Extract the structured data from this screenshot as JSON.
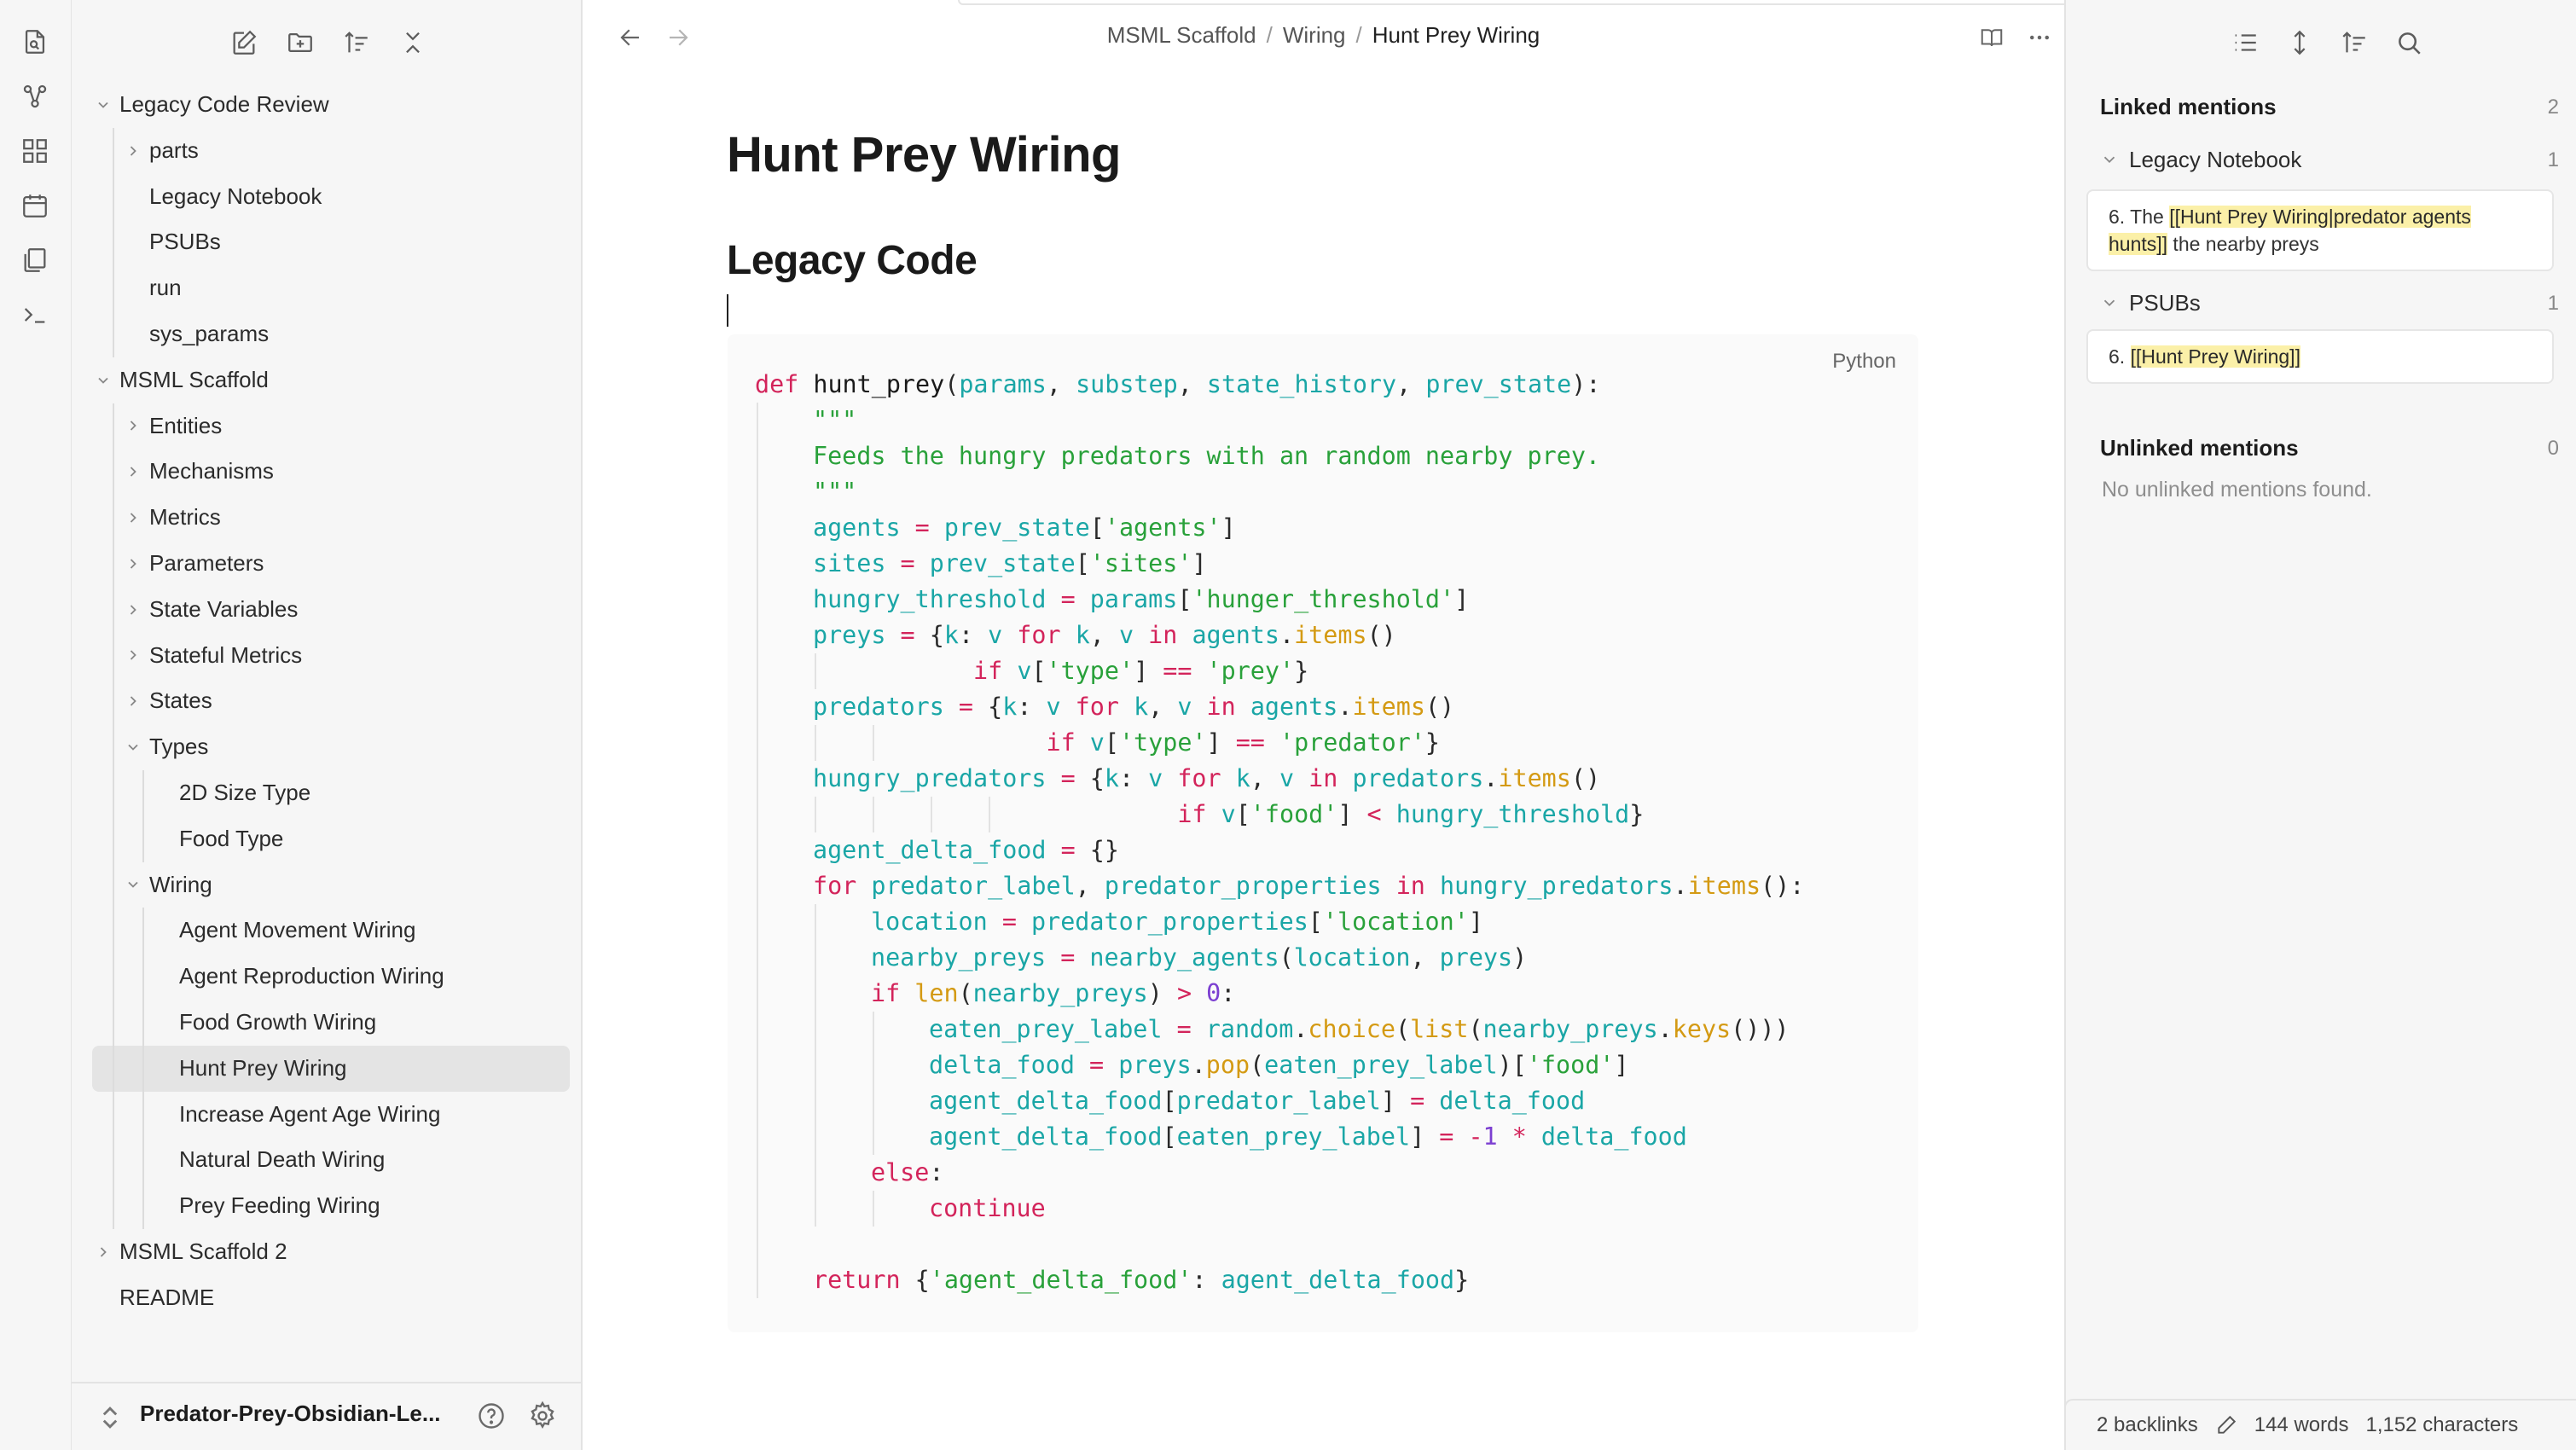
{
  "ribbon": {
    "icons": [
      "open-quick-switcher-icon",
      "graph-view-icon",
      "canvas-icon",
      "daily-note-icon",
      "templates-icon",
      "terminal-icon"
    ]
  },
  "sidebar": {
    "toolbar": [
      "new-note-icon",
      "new-folder-icon",
      "change-sort-order-icon",
      "collapse-all-icon"
    ],
    "tree": [
      {
        "label": "Legacy Code Review",
        "level": 0,
        "type": "folder-open"
      },
      {
        "label": "parts",
        "level": 1,
        "type": "folder-closed"
      },
      {
        "label": "Legacy Notebook",
        "level": 1,
        "type": "file"
      },
      {
        "label": "PSUBs",
        "level": 1,
        "type": "file"
      },
      {
        "label": "run",
        "level": 1,
        "type": "file"
      },
      {
        "label": "sys_params",
        "level": 1,
        "type": "file"
      },
      {
        "label": "MSML Scaffold",
        "level": 0,
        "type": "folder-open"
      },
      {
        "label": "Entities",
        "level": 1,
        "type": "folder-closed"
      },
      {
        "label": "Mechanisms",
        "level": 1,
        "type": "folder-closed"
      },
      {
        "label": "Metrics",
        "level": 1,
        "type": "folder-closed"
      },
      {
        "label": "Parameters",
        "level": 1,
        "type": "folder-closed"
      },
      {
        "label": "State Variables",
        "level": 1,
        "type": "folder-closed"
      },
      {
        "label": "Stateful Metrics",
        "level": 1,
        "type": "folder-closed"
      },
      {
        "label": "States",
        "level": 1,
        "type": "folder-closed"
      },
      {
        "label": "Types",
        "level": 1,
        "type": "folder-open"
      },
      {
        "label": "2D Size Type",
        "level": 2,
        "type": "file"
      },
      {
        "label": "Food Type",
        "level": 2,
        "type": "file"
      },
      {
        "label": "Wiring",
        "level": 1,
        "type": "folder-open"
      },
      {
        "label": "Agent Movement Wiring",
        "level": 2,
        "type": "file"
      },
      {
        "label": "Agent Reproduction Wiring",
        "level": 2,
        "type": "file"
      },
      {
        "label": "Food Growth Wiring",
        "level": 2,
        "type": "file"
      },
      {
        "label": "Hunt Prey Wiring",
        "level": 2,
        "type": "file",
        "active": true
      },
      {
        "label": "Increase Agent Age Wiring",
        "level": 2,
        "type": "file"
      },
      {
        "label": "Natural Death Wiring",
        "level": 2,
        "type": "file"
      },
      {
        "label": "Prey Feeding Wiring",
        "level": 2,
        "type": "file"
      },
      {
        "label": "MSML Scaffold 2",
        "level": 0,
        "type": "folder-closed"
      },
      {
        "label": "README",
        "level": 0,
        "type": "file"
      }
    ],
    "vault_name": "Predator-Prey-Obsidian-Le...",
    "help_icon": "help-icon",
    "settings_icon": "settings-icon"
  },
  "main": {
    "breadcrumb": [
      "MSML Scaffold",
      "Wiring",
      "Hunt Prey Wiring"
    ],
    "title": "Hunt Prey Wiring",
    "heading": "Legacy Code",
    "code_language": "Python",
    "code_lines": [
      {
        "indent": 0,
        "tokens": [
          [
            "k",
            "def "
          ],
          [
            "f",
            "hunt_prey"
          ],
          [
            "p",
            "("
          ],
          [
            "v",
            "params"
          ],
          [
            "p",
            ", "
          ],
          [
            "v",
            "substep"
          ],
          [
            "p",
            ", "
          ],
          [
            "v",
            "state_history"
          ],
          [
            "p",
            ", "
          ],
          [
            "v",
            "prev_state"
          ],
          [
            "p",
            "):"
          ]
        ]
      },
      {
        "indent": 1,
        "tokens": [
          [
            "s",
            "\"\"\""
          ]
        ]
      },
      {
        "indent": 1,
        "tokens": [
          [
            "s",
            "Feeds the hungry predators with an random nearby prey."
          ]
        ]
      },
      {
        "indent": 1,
        "tokens": [
          [
            "s",
            "\"\"\""
          ]
        ]
      },
      {
        "indent": 1,
        "tokens": [
          [
            "v",
            "agents"
          ],
          [
            "o",
            " = "
          ],
          [
            "v",
            "prev_state"
          ],
          [
            "p",
            "["
          ],
          [
            "s",
            "'agents'"
          ],
          [
            "p",
            "]"
          ]
        ]
      },
      {
        "indent": 1,
        "tokens": [
          [
            "v",
            "sites"
          ],
          [
            "o",
            " = "
          ],
          [
            "v",
            "prev_state"
          ],
          [
            "p",
            "["
          ],
          [
            "s",
            "'sites'"
          ],
          [
            "p",
            "]"
          ]
        ]
      },
      {
        "indent": 1,
        "tokens": [
          [
            "v",
            "hungry_threshold"
          ],
          [
            "o",
            " = "
          ],
          [
            "v",
            "params"
          ],
          [
            "p",
            "["
          ],
          [
            "s",
            "'hunger_threshold'"
          ],
          [
            "p",
            "]"
          ]
        ]
      },
      {
        "indent": 1,
        "tokens": [
          [
            "v",
            "preys"
          ],
          [
            "o",
            " = "
          ],
          [
            "p",
            "{"
          ],
          [
            "v",
            "k"
          ],
          [
            "p",
            ": "
          ],
          [
            "v",
            "v"
          ],
          [
            "k",
            " for "
          ],
          [
            "v",
            "k"
          ],
          [
            "p",
            ", "
          ],
          [
            "v",
            "v"
          ],
          [
            "k",
            " in "
          ],
          [
            "v",
            "agents"
          ],
          [
            "p",
            "."
          ],
          [
            "m",
            "items"
          ],
          [
            "p",
            "()"
          ]
        ]
      },
      {
        "indent": 1,
        "guides": [
          1
        ],
        "pre": "           ",
        "tokens": [
          [
            "k",
            "if "
          ],
          [
            "v",
            "v"
          ],
          [
            "p",
            "["
          ],
          [
            "s",
            "'type'"
          ],
          [
            "p",
            "] "
          ],
          [
            "o",
            "=="
          ],
          [
            "p",
            " "
          ],
          [
            "s",
            "'prey'"
          ],
          [
            "p",
            "}"
          ]
        ]
      },
      {
        "indent": 1,
        "tokens": [
          [
            "v",
            "predators"
          ],
          [
            "o",
            " = "
          ],
          [
            "p",
            "{"
          ],
          [
            "v",
            "k"
          ],
          [
            "p",
            ": "
          ],
          [
            "v",
            "v"
          ],
          [
            "k",
            " for "
          ],
          [
            "v",
            "k"
          ],
          [
            "p",
            ", "
          ],
          [
            "v",
            "v"
          ],
          [
            "k",
            " in "
          ],
          [
            "v",
            "agents"
          ],
          [
            "p",
            "."
          ],
          [
            "m",
            "items"
          ],
          [
            "p",
            "()"
          ]
        ]
      },
      {
        "indent": 1,
        "guides": [
          1,
          2
        ],
        "pre": "                ",
        "tokens": [
          [
            "k",
            "if "
          ],
          [
            "v",
            "v"
          ],
          [
            "p",
            "["
          ],
          [
            "s",
            "'type'"
          ],
          [
            "p",
            "] "
          ],
          [
            "o",
            "=="
          ],
          [
            "p",
            " "
          ],
          [
            "s",
            "'predator'"
          ],
          [
            "p",
            "}"
          ]
        ]
      },
      {
        "indent": 1,
        "tokens": [
          [
            "v",
            "hungry_predators"
          ],
          [
            "o",
            " = "
          ],
          [
            "p",
            "{"
          ],
          [
            "v",
            "k"
          ],
          [
            "p",
            ": "
          ],
          [
            "v",
            "v"
          ],
          [
            "k",
            " for "
          ],
          [
            "v",
            "k"
          ],
          [
            "p",
            ", "
          ],
          [
            "v",
            "v"
          ],
          [
            "k",
            " in "
          ],
          [
            "v",
            "predators"
          ],
          [
            "p",
            "."
          ],
          [
            "m",
            "items"
          ],
          [
            "p",
            "()"
          ]
        ]
      },
      {
        "indent": 1,
        "guides": [
          1,
          2,
          3,
          4
        ],
        "pre": "                         ",
        "tokens": [
          [
            "k",
            "if "
          ],
          [
            "v",
            "v"
          ],
          [
            "p",
            "["
          ],
          [
            "s",
            "'food'"
          ],
          [
            "p",
            "] "
          ],
          [
            "o",
            "<"
          ],
          [
            "p",
            " "
          ],
          [
            "v",
            "hungry_threshold"
          ],
          [
            "p",
            "}"
          ]
        ]
      },
      {
        "indent": 1,
        "tokens": [
          [
            "v",
            "agent_delta_food"
          ],
          [
            "o",
            " = "
          ],
          [
            "p",
            "{}"
          ]
        ]
      },
      {
        "indent": 1,
        "tokens": [
          [
            "k",
            "for "
          ],
          [
            "v",
            "predator_label"
          ],
          [
            "p",
            ", "
          ],
          [
            "v",
            "predator_properties"
          ],
          [
            "k",
            " in "
          ],
          [
            "v",
            "hungry_predators"
          ],
          [
            "p",
            "."
          ],
          [
            "m",
            "items"
          ],
          [
            "p",
            "():"
          ]
        ]
      },
      {
        "indent": 2,
        "tokens": [
          [
            "v",
            "location"
          ],
          [
            "o",
            " = "
          ],
          [
            "v",
            "predator_properties"
          ],
          [
            "p",
            "["
          ],
          [
            "s",
            "'location'"
          ],
          [
            "p",
            "]"
          ]
        ]
      },
      {
        "indent": 2,
        "tokens": [
          [
            "v",
            "nearby_preys"
          ],
          [
            "o",
            " = "
          ],
          [
            "v",
            "nearby_agents"
          ],
          [
            "p",
            "("
          ],
          [
            "v",
            "location"
          ],
          [
            "p",
            ", "
          ],
          [
            "v",
            "preys"
          ],
          [
            "p",
            ")"
          ]
        ]
      },
      {
        "indent": 2,
        "tokens": [
          [
            "k",
            "if "
          ],
          [
            "m",
            "len"
          ],
          [
            "p",
            "("
          ],
          [
            "v",
            "nearby_preys"
          ],
          [
            "p",
            ") "
          ],
          [
            "o",
            ">"
          ],
          [
            "p",
            " "
          ],
          [
            "n",
            "0"
          ],
          [
            "p",
            ":"
          ]
        ]
      },
      {
        "indent": 3,
        "tokens": [
          [
            "v",
            "eaten_prey_label"
          ],
          [
            "o",
            " = "
          ],
          [
            "v",
            "random"
          ],
          [
            "p",
            "."
          ],
          [
            "m",
            "choice"
          ],
          [
            "p",
            "("
          ],
          [
            "m",
            "list"
          ],
          [
            "p",
            "("
          ],
          [
            "v",
            "nearby_preys"
          ],
          [
            "p",
            "."
          ],
          [
            "m",
            "keys"
          ],
          [
            "p",
            "()))"
          ]
        ]
      },
      {
        "indent": 3,
        "tokens": [
          [
            "v",
            "delta_food"
          ],
          [
            "o",
            " = "
          ],
          [
            "v",
            "preys"
          ],
          [
            "p",
            "."
          ],
          [
            "m",
            "pop"
          ],
          [
            "p",
            "("
          ],
          [
            "v",
            "eaten_prey_label"
          ],
          [
            "p",
            ")["
          ],
          [
            "s",
            "'food'"
          ],
          [
            "p",
            "]"
          ]
        ]
      },
      {
        "indent": 3,
        "tokens": [
          [
            "v",
            "agent_delta_food"
          ],
          [
            "p",
            "["
          ],
          [
            "v",
            "predator_label"
          ],
          [
            "p",
            "] "
          ],
          [
            "o",
            "="
          ],
          [
            "p",
            " "
          ],
          [
            "v",
            "delta_food"
          ]
        ]
      },
      {
        "indent": 3,
        "tokens": [
          [
            "v",
            "agent_delta_food"
          ],
          [
            "p",
            "["
          ],
          [
            "v",
            "eaten_prey_label"
          ],
          [
            "p",
            "] "
          ],
          [
            "o",
            "="
          ],
          [
            "p",
            " "
          ],
          [
            "o",
            "-"
          ],
          [
            "n",
            "1"
          ],
          [
            "p",
            " "
          ],
          [
            "o",
            "*"
          ],
          [
            "p",
            " "
          ],
          [
            "v",
            "delta_food"
          ]
        ]
      },
      {
        "indent": 2,
        "tokens": [
          [
            "k",
            "else"
          ],
          [
            "p",
            ":"
          ]
        ]
      },
      {
        "indent": 3,
        "tokens": [
          [
            "k",
            "continue"
          ]
        ]
      },
      {
        "indent": 1,
        "blank": true,
        "tokens": []
      },
      {
        "indent": 1,
        "tokens": [
          [
            "k",
            "return "
          ],
          [
            "p",
            "{"
          ],
          [
            "s",
            "'agent_delta_food'"
          ],
          [
            "p",
            ": "
          ],
          [
            "v",
            "agent_delta_food"
          ],
          [
            "p",
            "}"
          ]
        ]
      }
    ]
  },
  "backlinks": {
    "linked_title": "Linked mentions",
    "linked_count": "2",
    "groups": [
      {
        "name": "Legacy Notebook",
        "count": "1",
        "snippet_pre": "6. The ",
        "snippet_hl": "[[Hunt Prey Wiring|predator agents hunts]]",
        "snippet_post": " the nearby preys"
      },
      {
        "name": "PSUBs",
        "count": "1",
        "snippet_pre": "6. ",
        "snippet_hl": "[[Hunt Prey Wiring]]",
        "snippet_post": ""
      }
    ],
    "unlinked_title": "Unlinked mentions",
    "unlinked_count": "0",
    "unlinked_empty": "No unlinked mentions found."
  },
  "status_bar": {
    "backlinks": "2 backlinks",
    "words": "144 words",
    "characters": "1,152 characters"
  }
}
